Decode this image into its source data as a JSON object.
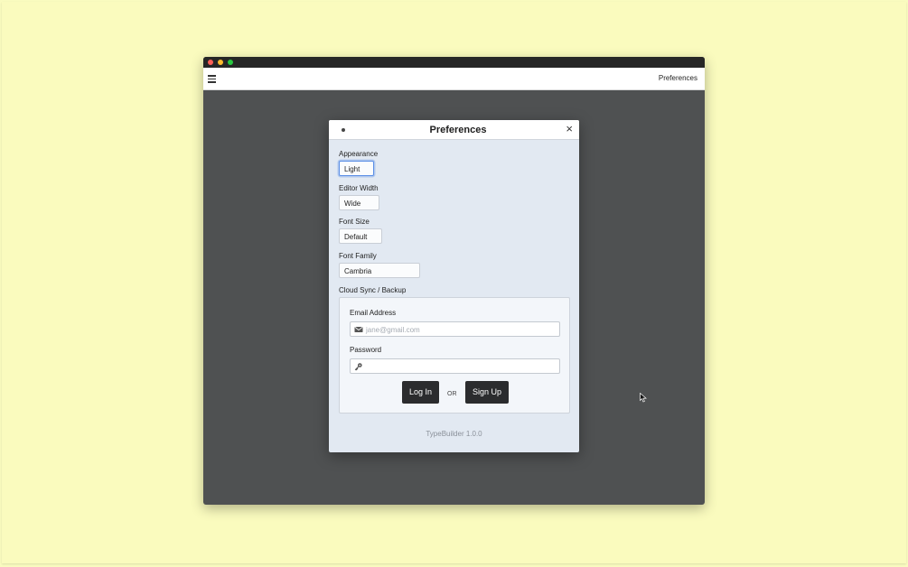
{
  "app": {
    "title": "Preferences"
  },
  "dialog": {
    "title": "Preferences",
    "close_symbol": "×",
    "appearance": {
      "label": "Appearance",
      "value": "Light"
    },
    "editor_width": {
      "label": "Editor Width",
      "value": "Wide"
    },
    "font_size": {
      "label": "Font Size",
      "value": "Default"
    },
    "font_family": {
      "label": "Font Family",
      "value": "Cambria"
    },
    "sync": {
      "label": "Cloud Sync / Backup",
      "email": {
        "label": "Email Address",
        "placeholder": "jane@gmail.com",
        "value": ""
      },
      "password": {
        "label": "Password",
        "value": ""
      },
      "login_label": "Log In",
      "or_label": "OR",
      "signup_label": "Sign Up"
    },
    "version": "TypeBuilder 1.0.0"
  },
  "icons": {
    "menu": "hamburger-menu-icon",
    "close": "close-icon",
    "email": "envelope-icon",
    "password": "key-icon"
  },
  "colors": {
    "background": "#f9fbbf",
    "window_body": "#4f5152",
    "dialog_body": "#e2e9f2",
    "button": "#2b2c2e",
    "focus": "#5b8fe6"
  }
}
